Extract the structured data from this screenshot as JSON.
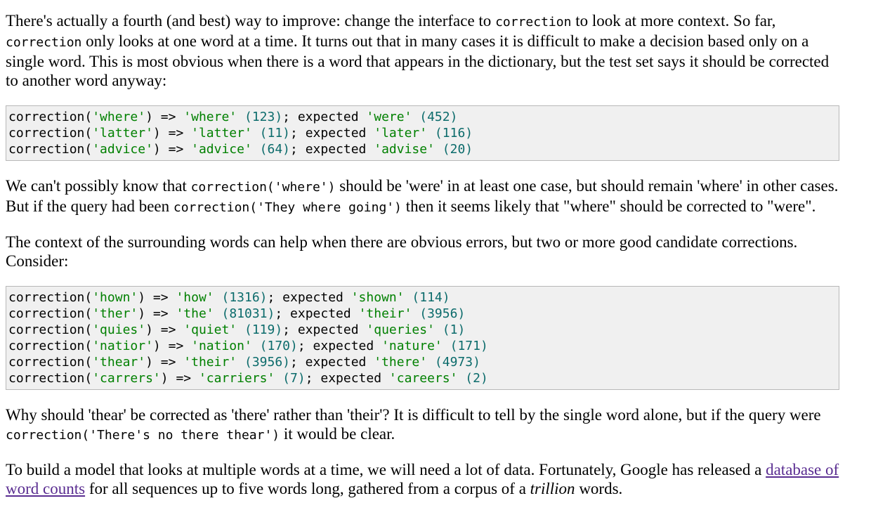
{
  "intro_paragraph": {
    "part1": "There's actually a fourth (and best) way to improve: change the interface to ",
    "code1": "correction",
    "part2": " to look at more context. So far, ",
    "code2": "correction",
    "part3": " only looks at one word at a time. It turns out that in many cases it is difficult to make a decision based only on a single word. This is most obvious when there is a word that appears in the dictionary, but the test set says it should be corrected to another word anyway:"
  },
  "code_block_1": [
    {
      "fn": "correction(",
      "arg": "'where'",
      "close": ")",
      "arrow": " => ",
      "result": "'where'",
      "count": " (123)",
      "semi": "; expected ",
      "expected": "'were'",
      "ecount": " (452)"
    },
    {
      "fn": "correction(",
      "arg": "'latter'",
      "close": ")",
      "arrow": " => ",
      "result": "'latter'",
      "count": " (11)",
      "semi": "; expected ",
      "expected": "'later'",
      "ecount": " (116)"
    },
    {
      "fn": "correction(",
      "arg": "'advice'",
      "close": ")",
      "arrow": " => ",
      "result": "'advice'",
      "count": " (64)",
      "semi": "; expected ",
      "expected": "'advise'",
      "ecount": " (20)"
    }
  ],
  "paragraph_2": {
    "part1": "We can't possibly know that ",
    "code1": "correction('where')",
    "part2": " should be 'were' in at least one case, but should remain 'where' in other cases. But if the query had been ",
    "code2": "correction('They where going')",
    "part3": " then it seems likely that \"where\" should be corrected to \"were\"."
  },
  "paragraph_3": "The context of the surrounding words can help when there are obvious errors, but two or more good candidate corrections. Consider:",
  "code_block_2": [
    {
      "fn": "correction(",
      "arg": "'hown'",
      "close": ")",
      "arrow": " => ",
      "result": "'how'",
      "count": " (1316)",
      "semi": "; expected ",
      "expected": "'shown'",
      "ecount": " (114)"
    },
    {
      "fn": "correction(",
      "arg": "'ther'",
      "close": ")",
      "arrow": " => ",
      "result": "'the'",
      "count": " (81031)",
      "semi": "; expected ",
      "expected": "'their'",
      "ecount": " (3956)"
    },
    {
      "fn": "correction(",
      "arg": "'quies'",
      "close": ")",
      "arrow": " => ",
      "result": "'quiet'",
      "count": " (119)",
      "semi": "; expected ",
      "expected": "'queries'",
      "ecount": " (1)"
    },
    {
      "fn": "correction(",
      "arg": "'natior'",
      "close": ")",
      "arrow": " => ",
      "result": "'nation'",
      "count": " (170)",
      "semi": "; expected ",
      "expected": "'nature'",
      "ecount": " (171)"
    },
    {
      "fn": "correction(",
      "arg": "'thear'",
      "close": ")",
      "arrow": " => ",
      "result": "'their'",
      "count": " (3956)",
      "semi": "; expected ",
      "expected": "'there'",
      "ecount": " (4973)"
    },
    {
      "fn": "correction(",
      "arg": "'carrers'",
      "close": ")",
      "arrow": " => ",
      "result": "'carriers'",
      "count": " (7)",
      "semi": "; expected ",
      "expected": "'careers'",
      "ecount": " (2)"
    }
  ],
  "paragraph_4": {
    "part1": "Why should 'thear' be corrected as 'there' rather than 'their'? It is difficult to tell by the single word alone, but if the query were ",
    "code1": "correction('There's no there thear')",
    "part2": " it would be clear."
  },
  "paragraph_5": {
    "part1": "To build a model that looks at multiple words at a time, we will need a lot of data. Fortunately, Google has released a ",
    "link_text": "database of word counts",
    "part2": " for all sequences up to five words long, gathered from a corpus of a ",
    "emphasis": "trillion",
    "part3": " words."
  },
  "colors": {
    "string": "#008000",
    "number": "#0b6b6b",
    "link": "#5a2d91",
    "code_background": "#f0f0f0"
  }
}
